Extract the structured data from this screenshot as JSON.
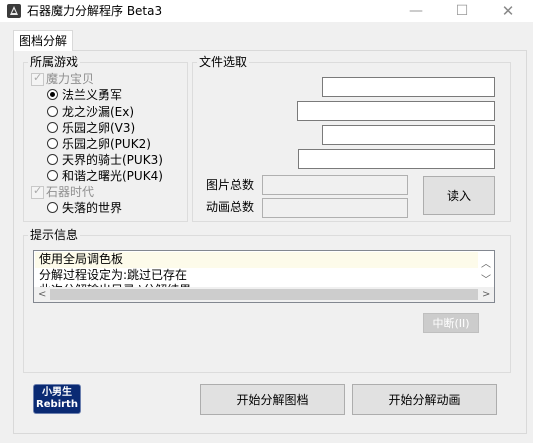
{
  "window": {
    "title": "石器魔力分解程序 Beta3",
    "min_glyph": "—",
    "max_glyph": "☐",
    "close_glyph": "✕"
  },
  "tab": {
    "label": "图档分解"
  },
  "game_group": {
    "title": "所属游戏",
    "crossgate_label": "魔力宝贝",
    "crossgate_options": [
      "法兰义勇军",
      "龙之沙漏(Ex)",
      "乐园之卵(V3)",
      "乐园之卵(PUK2)",
      "天界的骑士(PUK3)",
      "和谐之曙光(PUK4)"
    ],
    "selected_index": 0,
    "stoneage_label": "石器时代",
    "stoneage_options": [
      "失落的世界"
    ]
  },
  "file_group": {
    "title": "文件选取",
    "pic_total_label": "图片总数",
    "anim_total_label": "动画总数",
    "read_button": "读入"
  },
  "info_group": {
    "title": "提示信息",
    "lines": [
      "使用全局调色板",
      "分解过程设定为:跳过已存在",
      "此次分解输出目录:\\分解结果"
    ],
    "interrupt_button": "中断(II)"
  },
  "logo": {
    "line1": "小男生",
    "line2": "Rebirth"
  },
  "actions": {
    "split_images": "开始分解图档",
    "split_animations": "开始分解动画"
  }
}
